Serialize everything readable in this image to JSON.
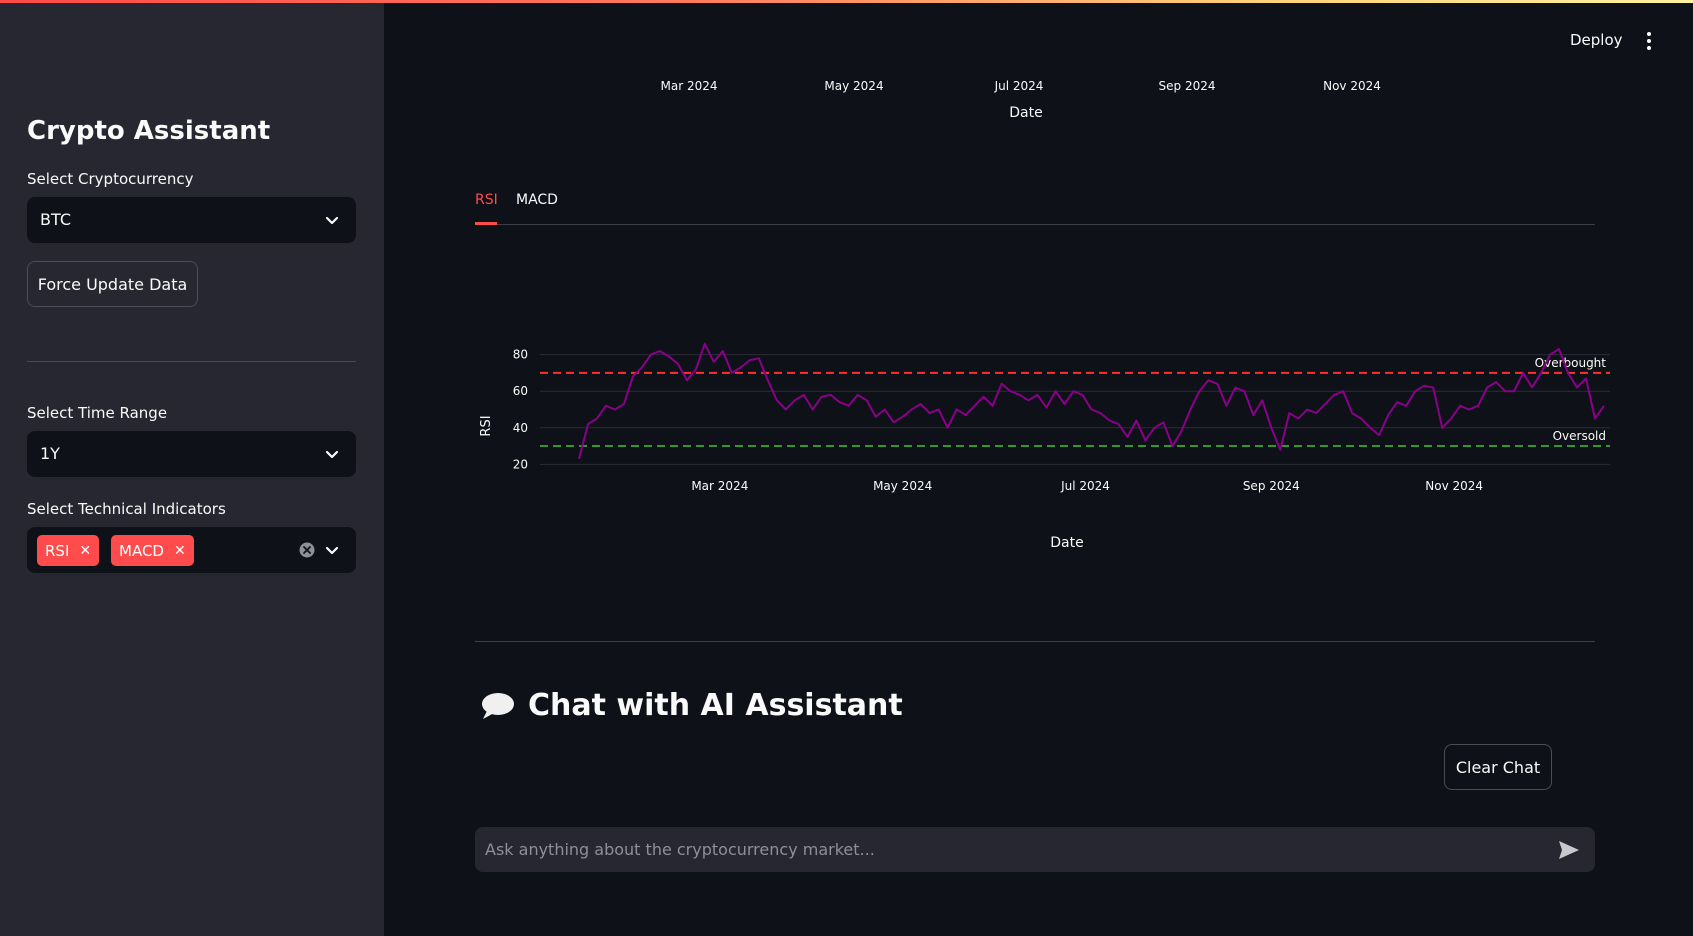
{
  "sidebar": {
    "title": "Crypto Assistant",
    "crypto_label": "Select Cryptocurrency",
    "crypto_value": "BTC",
    "force_update_label": "Force Update Data",
    "time_range_label": "Select Time Range",
    "time_range_value": "1Y",
    "indicators_label": "Select Technical Indicators",
    "indicators": [
      "RSI",
      "MACD"
    ]
  },
  "header": {
    "deploy_label": "Deploy"
  },
  "top_chart_axis": {
    "ticks": [
      "Mar 2024",
      "May 2024",
      "Jul 2024",
      "Sep 2024",
      "Nov 2024"
    ],
    "xlabel": "Date"
  },
  "tabs": [
    {
      "label": "RSI",
      "active": true
    },
    {
      "label": "MACD",
      "active": false
    }
  ],
  "chart_data": {
    "type": "line",
    "title": "",
    "xlabel": "Date",
    "ylabel": "RSI",
    "x_ticks": [
      "Mar 2024",
      "May 2024",
      "Jul 2024",
      "Sep 2024",
      "Nov 2024"
    ],
    "y_ticks": [
      20,
      40,
      60,
      80
    ],
    "ylim": [
      18,
      88
    ],
    "x": [
      "2024-01-14",
      "2024-01-17",
      "2024-01-20",
      "2024-01-23",
      "2024-01-26",
      "2024-01-29",
      "2024-02-01",
      "2024-02-04",
      "2024-02-07",
      "2024-02-10",
      "2024-02-13",
      "2024-02-16",
      "2024-02-19",
      "2024-02-22",
      "2024-02-25",
      "2024-02-28",
      "2024-03-02",
      "2024-03-05",
      "2024-03-08",
      "2024-03-11",
      "2024-03-14",
      "2024-03-17",
      "2024-03-20",
      "2024-03-23",
      "2024-03-26",
      "2024-03-29",
      "2024-04-01",
      "2024-04-04",
      "2024-04-07",
      "2024-04-10",
      "2024-04-13",
      "2024-04-16",
      "2024-04-19",
      "2024-04-22",
      "2024-04-25",
      "2024-04-28",
      "2024-05-01",
      "2024-05-04",
      "2024-05-07",
      "2024-05-10",
      "2024-05-13",
      "2024-05-16",
      "2024-05-19",
      "2024-05-22",
      "2024-05-25",
      "2024-05-28",
      "2024-05-31",
      "2024-06-03",
      "2024-06-06",
      "2024-06-09",
      "2024-06-12",
      "2024-06-15",
      "2024-06-18",
      "2024-06-21",
      "2024-06-24",
      "2024-06-27",
      "2024-06-30",
      "2024-07-03",
      "2024-07-06",
      "2024-07-09",
      "2024-07-12",
      "2024-07-15",
      "2024-07-18",
      "2024-07-21",
      "2024-07-24",
      "2024-07-27",
      "2024-07-30",
      "2024-08-02",
      "2024-08-05",
      "2024-08-08",
      "2024-08-11",
      "2024-08-14",
      "2024-08-17",
      "2024-08-20",
      "2024-08-23",
      "2024-08-26",
      "2024-08-29",
      "2024-09-01",
      "2024-09-04",
      "2024-09-07",
      "2024-09-10",
      "2024-09-13",
      "2024-09-16",
      "2024-09-19",
      "2024-09-22",
      "2024-09-25",
      "2024-09-28",
      "2024-10-01",
      "2024-10-04",
      "2024-10-07",
      "2024-10-10",
      "2024-10-13",
      "2024-10-16",
      "2024-10-19",
      "2024-10-22",
      "2024-10-25",
      "2024-10-28",
      "2024-10-31",
      "2024-11-03",
      "2024-11-06",
      "2024-11-09",
      "2024-11-12",
      "2024-11-15",
      "2024-11-18",
      "2024-11-21",
      "2024-11-24",
      "2024-11-27",
      "2024-11-30",
      "2024-12-03",
      "2024-12-06",
      "2024-12-09",
      "2024-12-12",
      "2024-12-15",
      "2024-12-18",
      "2024-12-21"
    ],
    "series": [
      {
        "color": "#8b008b",
        "values": [
          23,
          42,
          45,
          52,
          50,
          53,
          68,
          73,
          80,
          82,
          79,
          75,
          66,
          72,
          86,
          76,
          82,
          70,
          73,
          77,
          78,
          66,
          55,
          50,
          55,
          58,
          50,
          57,
          58,
          54,
          52,
          58,
          55,
          46,
          50,
          43,
          46,
          50,
          53,
          48,
          50,
          40,
          50,
          47,
          52,
          57,
          52,
          64,
          60,
          58,
          55,
          58,
          51,
          60,
          53,
          60,
          58,
          50,
          48,
          44,
          42,
          35,
          44,
          33,
          40,
          43,
          30,
          38,
          50,
          60,
          66,
          64,
          52,
          62,
          60,
          47,
          55,
          40,
          28,
          48,
          45,
          50,
          48,
          53,
          58,
          60,
          48,
          45,
          40,
          36,
          47,
          54,
          52,
          60,
          63,
          62,
          40,
          45,
          52,
          50,
          52,
          62,
          65,
          60,
          60,
          70,
          62,
          70,
          80,
          83,
          70,
          62,
          67,
          45,
          52
        ]
      }
    ],
    "reference_lines": [
      {
        "label": "Overbought",
        "y": 70,
        "color": "#ff3030"
      },
      {
        "label": "Oversold",
        "y": 30,
        "color": "#2e9a2e"
      }
    ]
  },
  "chat": {
    "heading": "Chat with AI Assistant",
    "clear_label": "Clear Chat",
    "placeholder": "Ask anything about the cryptocurrency market..."
  }
}
